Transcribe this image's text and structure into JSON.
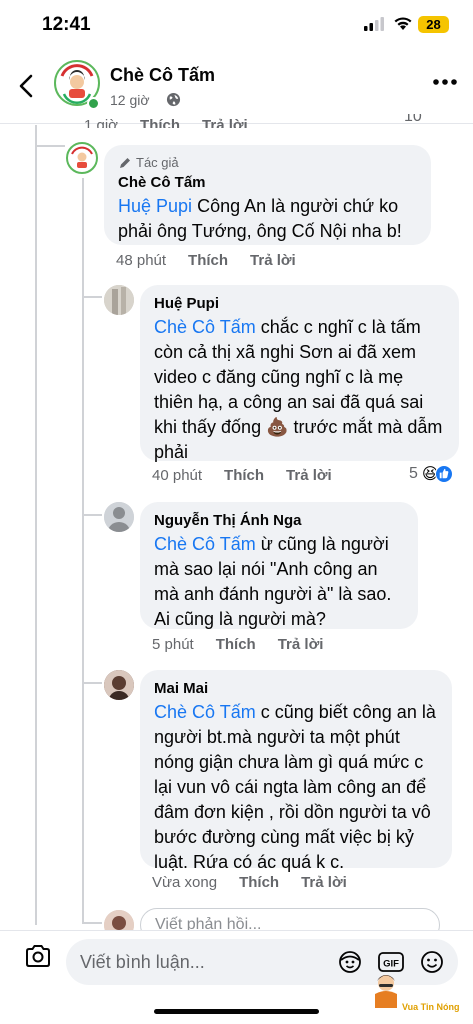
{
  "status_bar": {
    "time": "12:41",
    "battery": "28"
  },
  "header": {
    "page_name": "Chè Cô Tấm",
    "post_time": "12 giờ"
  },
  "partial_row": {
    "time": "1 giờ",
    "like": "Thích",
    "reply": "Trả lời",
    "reaction_count": "10"
  },
  "comments": [
    {
      "author_badge": "Tác giả",
      "name": "Chè Cô Tấm",
      "mention": "Huệ Pupi",
      "text": " Công An là người chứ ko phải ông Tướng, ông Cố Nội nha b!",
      "time": "48 phút",
      "like": "Thích",
      "reply": "Trả lời"
    },
    {
      "name": "Huệ Pupi",
      "mention": "Chè Cô Tấm",
      "text_before": " chắc c nghĩ c là tấm còn cả thị xã nghi Sơn ai đã xem video c đăng cũng nghĩ c là mẹ thiên hạ,  a công an sai đã quá sai khi thấy đống ",
      "emoji": "💩",
      "text_after": " trước mắt mà dẫm phải",
      "time": "40 phút",
      "like": "Thích",
      "reply": "Trả lời",
      "reaction_count": "5",
      "reaction_icons": [
        "😆",
        "👍"
      ]
    },
    {
      "name": "Nguyễn Thị Ánh Nga",
      "mention": "Chè Cô Tấm",
      "text": " ừ cũng là người mà sao lại nói \"Anh công an mà anh đánh người à\" là sao. Ai cũng là người mà?",
      "time": "5 phút",
      "like": "Thích",
      "reply": "Trả lời"
    },
    {
      "name": "Mai Mai",
      "mention": "Chè Cô Tấm",
      "text": " c cũng biết công an là người bt.mà người ta một phút nóng giận chưa làm gì quá mức c lại vun vô cái ngta làm công an để đâm đơn kiện , rồi dồn người ta vô bước đường cùng mất việc bị kỷ luật. Rứa có ác quá k c.",
      "time": "Vừa xong",
      "like": "Thích",
      "reply": "Trả lời"
    }
  ],
  "reply_placeholder": "Viết phản hồi...",
  "bottom_bar": {
    "placeholder": "Viết bình luận..."
  },
  "watermark": "Vua Tin Nóng",
  "colors": {
    "mention": "#1877f2",
    "bubble": "#f0f2f5",
    "online": "#31a24c",
    "battery": "#f5c400"
  }
}
